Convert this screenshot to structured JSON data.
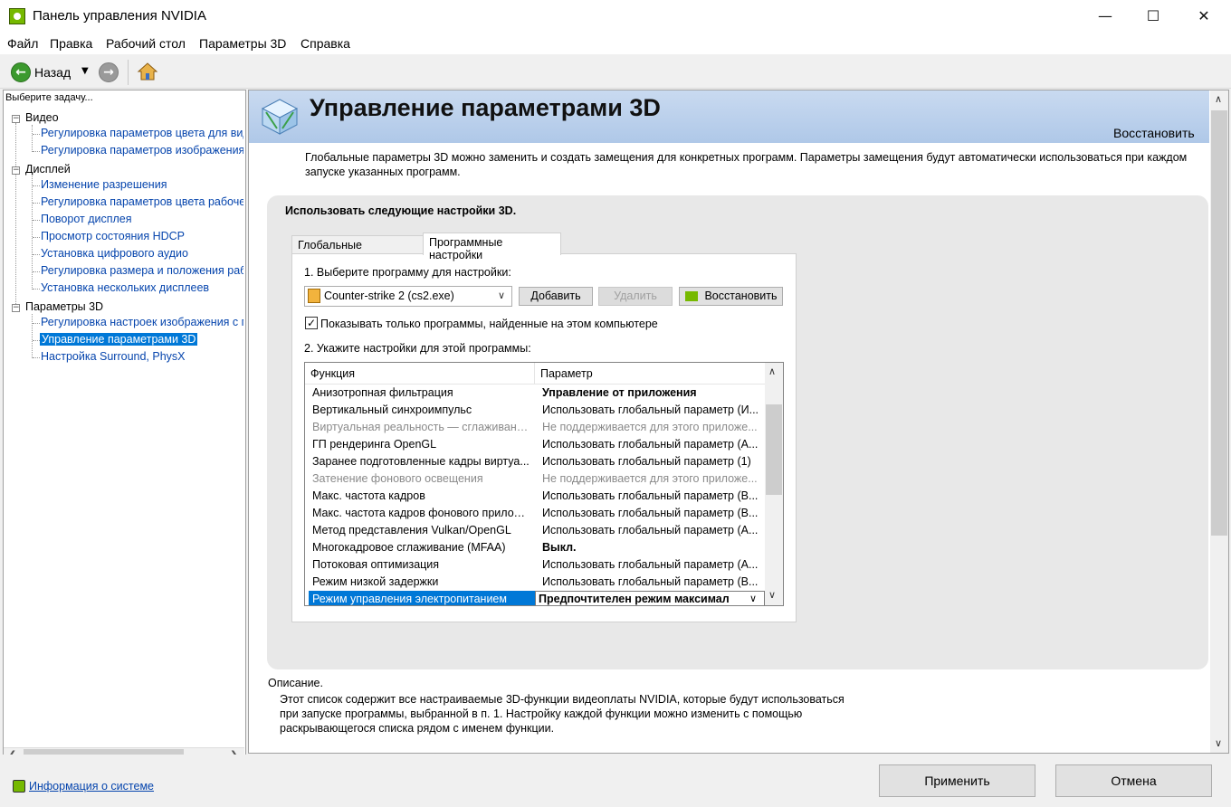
{
  "window": {
    "title": "Панель управления NVIDIA",
    "controls": {
      "minimize": "—",
      "maximize": "☐",
      "close": "✕"
    }
  },
  "menu": [
    "Файл",
    "Правка",
    "Рабочий стол",
    "Параметры 3D",
    "Справка"
  ],
  "toolbar": {
    "back_label": "Назад"
  },
  "left": {
    "task_label": "Выберите задачу...",
    "categories": [
      {
        "label": "Видео",
        "items": [
          "Регулировка параметров цвета для видео",
          "Регулировка параметров изображения для видео"
        ]
      },
      {
        "label": "Дисплей",
        "items": [
          "Изменение разрешения",
          "Регулировка параметров цвета рабочего стола",
          "Поворот дисплея",
          "Просмотр состояния HDCP",
          "Установка цифрового аудио",
          "Регулировка размера и положения рабочего стола",
          "Установка нескольких дисплеев"
        ]
      },
      {
        "label": "Параметры 3D",
        "items": [
          "Регулировка настроек изображения с просмотром",
          "Управление параметрами 3D",
          "Настройка Surround, PhysX"
        ]
      }
    ],
    "system_info": "Информация о системе"
  },
  "main": {
    "title": "Управление параметрами 3D",
    "restore_link": "Восстановить",
    "intro": "Глобальные параметры 3D можно заменить и создать замещения для конкретных программ. Параметры замещения будут автоматически использоваться при каждом запуске указанных программ.",
    "settings_heading": "Использовать следующие настройки 3D.",
    "tabs": [
      "Глобальные параметры",
      "Программные настройки"
    ],
    "step1": "1. Выберите программу для настройки:",
    "program": "Counter-strike 2 (cs2.exe)",
    "add_button": "Добавить",
    "remove_button": "Удалить",
    "restore_button": "Восстановить",
    "show_only_label": "Показывать только программы, найденные на этом компьютере",
    "step2": "2. Укажите настройки для этой программы:",
    "table": {
      "headers": [
        "Функция",
        "Параметр"
      ],
      "rows": [
        {
          "f": "Анизотропная фильтрация",
          "p": "Управление от приложения",
          "bold": true,
          "disabled": false
        },
        {
          "f": "Вертикальный синхроимпульс",
          "p": "Использовать глобальный параметр (И...",
          "bold": false,
          "disabled": false
        },
        {
          "f": "Виртуальная реальность — сглаживани...",
          "p": "Не поддерживается для этого приложе...",
          "bold": false,
          "disabled": true
        },
        {
          "f": "ГП рендеринга OpenGL",
          "p": "Использовать глобальный параметр (А...",
          "bold": false,
          "disabled": false
        },
        {
          "f": "Заранее подготовленные кадры виртуа...",
          "p": "Использовать глобальный параметр (1)",
          "bold": false,
          "disabled": false
        },
        {
          "f": "Затенение фонового освещения",
          "p": "Не поддерживается для этого приложе...",
          "bold": false,
          "disabled": true
        },
        {
          "f": "Макс. частота кадров",
          "p": "Использовать глобальный параметр (В...",
          "bold": false,
          "disabled": false
        },
        {
          "f": "Макс. частота кадров фонового прилож...",
          "p": "Использовать глобальный параметр (В...",
          "bold": false,
          "disabled": false
        },
        {
          "f": "Метод представления Vulkan/OpenGL",
          "p": "Использовать глобальный параметр (А...",
          "bold": false,
          "disabled": false
        },
        {
          "f": "Многокадровое сглаживание (MFAA)",
          "p": "Выкл.",
          "bold": true,
          "disabled": false
        },
        {
          "f": "Потоковая оптимизация",
          "p": "Использовать глобальный параметр (А...",
          "bold": false,
          "disabled": false
        },
        {
          "f": "Режим низкой задержки",
          "p": "Использовать глобальный параметр (В...",
          "bold": false,
          "disabled": false
        }
      ],
      "selected_row": {
        "f": "Режим управления электропитанием",
        "p": "Предпочтителен режим максимал"
      }
    },
    "description_label": "Описание.",
    "description": "Этот список содержит все настраиваемые 3D-функции видеоплаты NVIDIA, которые будут использоваться при запуске программы, выбранной в п. 1. Настройку каждой функции можно изменить с помощью раскрывающегося списка рядом с именем функции."
  },
  "footer": {
    "apply": "Применить",
    "cancel": "Отмена"
  }
}
